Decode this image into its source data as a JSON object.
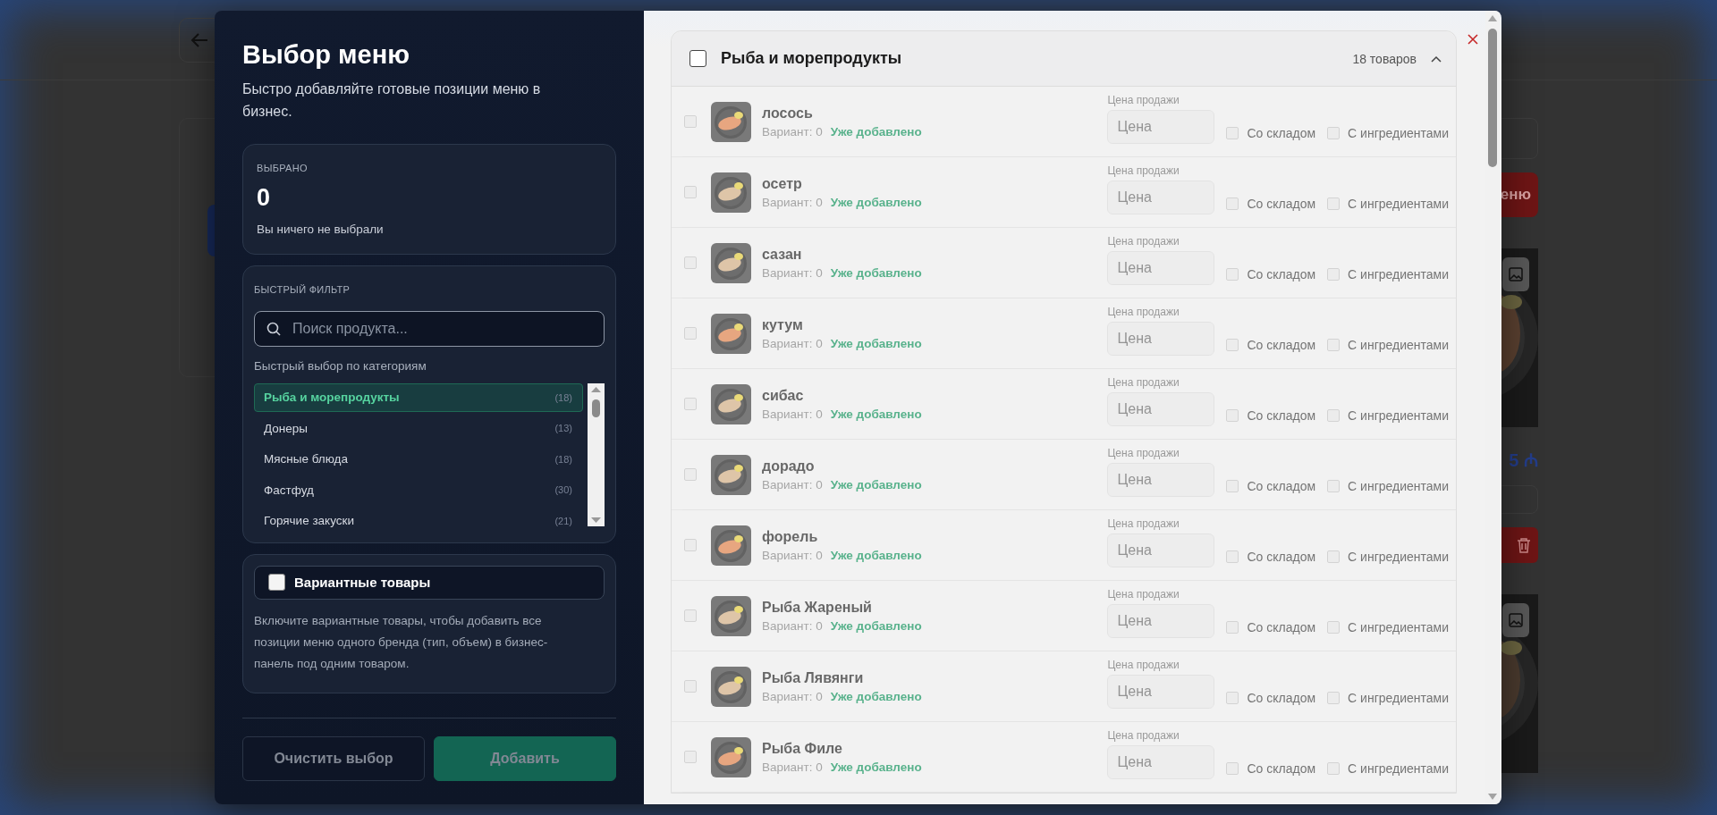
{
  "backdrop": {
    "menu_button": "еню",
    "price": "5 ₼"
  },
  "sidebar": {
    "title": "Выбор меню",
    "subtitle": "Быстро добавляйте готовые позиции меню в бизнес.",
    "selected_card": {
      "label": "ВЫБРАНО",
      "count": "0",
      "note": "Вы ничего не выбрали"
    },
    "filter": {
      "label": "БЫСТРЫЙ ФИЛЬТР",
      "search_placeholder": "Поиск продукта...",
      "categories_label": "Быстрый выбор по категориям",
      "categories": [
        {
          "name": "Рыба и морепродукты",
          "count": "(18)",
          "selected": true
        },
        {
          "name": "Донеры",
          "count": "(13)",
          "selected": false
        },
        {
          "name": "Мясные блюда",
          "count": "(18)",
          "selected": false
        },
        {
          "name": "Фастфуд",
          "count": "(30)",
          "selected": false
        },
        {
          "name": "Горячие закуски",
          "count": "(21)",
          "selected": false
        }
      ]
    },
    "variants": {
      "label": "Вариантные товары",
      "checked": false,
      "help": "Включите вариантные товары, чтобы добавить все позиции меню одного бренда (тип, объем) в бизнес-панель под одним товаром."
    },
    "buttons": [
      {
        "label": "Очистить выбор",
        "kind": "secondary"
      },
      {
        "label": "Добавить",
        "kind": "primary"
      }
    ]
  },
  "group": {
    "title": "Рыба и морепродукты",
    "checked": false,
    "count": "18 товаров",
    "expanded": true,
    "items": [
      {
        "name": "лосось",
        "variant": "Вариант: 0",
        "status": "Уже добавлено",
        "disabled": true,
        "price_label": "Цена продажи",
        "price_placeholder": "Цена",
        "stock_label": "Со складом",
        "stock": false,
        "ingredients_label": "С ингредиентами",
        "ingredients": false
      },
      {
        "name": "осетр",
        "variant": "Вариант: 0",
        "status": "Уже добавлено",
        "disabled": true,
        "price_label": "Цена продажи",
        "price_placeholder": "Цена",
        "stock_label": "Со складом",
        "stock": false,
        "ingredients_label": "С ингредиентами",
        "ingredients": false
      },
      {
        "name": "сазан",
        "variant": "Вариант: 0",
        "status": "Уже добавлено",
        "disabled": true,
        "price_label": "Цена продажи",
        "price_placeholder": "Цена",
        "stock_label": "Со складом",
        "stock": false,
        "ingredients_label": "С ингредиентами",
        "ingredients": false
      },
      {
        "name": "кутум",
        "variant": "Вариант: 0",
        "status": "Уже добавлено",
        "disabled": true,
        "price_label": "Цена продажи",
        "price_placeholder": "Цена",
        "stock_label": "Со складом",
        "stock": false,
        "ingredients_label": "С ингредиентами",
        "ingredients": false
      },
      {
        "name": "сибас",
        "variant": "Вариант: 0",
        "status": "Уже добавлено",
        "disabled": true,
        "price_label": "Цена продажи",
        "price_placeholder": "Цена",
        "stock_label": "Со складом",
        "stock": false,
        "ingredients_label": "С ингредиентами",
        "ingredients": false
      },
      {
        "name": "дорадо",
        "variant": "Вариант: 0",
        "status": "Уже добавлено",
        "disabled": true,
        "price_label": "Цена продажи",
        "price_placeholder": "Цена",
        "stock_label": "Со складом",
        "stock": false,
        "ingredients_label": "С ингредиентами",
        "ingredients": false
      },
      {
        "name": "форель",
        "variant": "Вариант: 0",
        "status": "Уже добавлено",
        "disabled": true,
        "price_label": "Цена продажи",
        "price_placeholder": "Цена",
        "stock_label": "Со складом",
        "stock": false,
        "ingredients_label": "С ингредиентами",
        "ingredients": false
      },
      {
        "name": "Рыба Жареный",
        "variant": "Вариант: 0",
        "status": "Уже добавлено",
        "disabled": true,
        "price_label": "Цена продажи",
        "price_placeholder": "Цена",
        "stock_label": "Со складом",
        "stock": false,
        "ingredients_label": "С ингредиентами",
        "ingredients": false
      },
      {
        "name": "Рыба Лявянги",
        "variant": "Вариант: 0",
        "status": "Уже добавлено",
        "disabled": true,
        "price_label": "Цена продажи",
        "price_placeholder": "Цена",
        "stock_label": "Со складом",
        "stock": false,
        "ingredients_label": "С ингредиентами",
        "ingredients": false
      },
      {
        "name": "Рыба Филе",
        "variant": "Вариант: 0",
        "status": "Уже добавлено",
        "disabled": true,
        "price_label": "Цена продажи",
        "price_placeholder": "Цена",
        "stock_label": "Со складом",
        "stock": false,
        "ingredients_label": "С ингредиентами",
        "ingredients": false
      }
    ]
  }
}
